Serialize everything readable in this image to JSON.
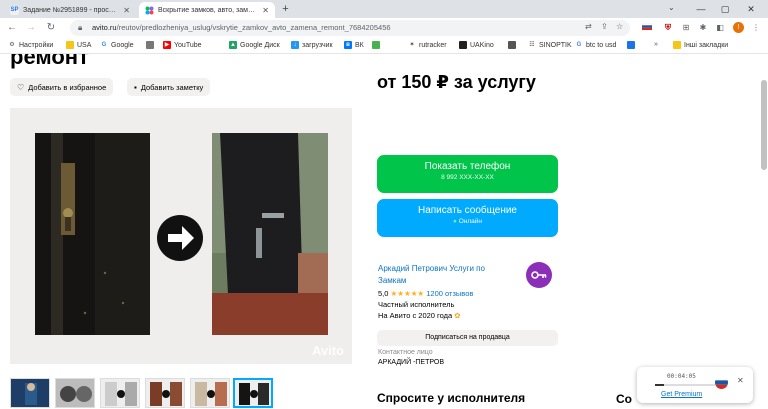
{
  "browser": {
    "tabs": [
      {
        "title": "Задание №2951899 - просмотр",
        "favicon": "SP",
        "active": false
      },
      {
        "title": "Вскрытие замков, авто, замена",
        "favicon": "avito",
        "active": true
      }
    ],
    "url_host": "avito.ru",
    "url_path": "/reutov/predlozheniya_uslug/vskrytie_zamkov_avto_zamena_remont_7684205456"
  },
  "bookmarks": {
    "items": [
      "Настройки",
      "USA",
      "Google",
      "",
      "YouTube",
      "Google Диск",
      "загрузчик",
      "ВК",
      "",
      "rutracker",
      "UAKino",
      "",
      "SINOPTIK",
      "btc to usd",
      ""
    ],
    "other": "Інші закладки"
  },
  "page": {
    "title_partial": "ремонт",
    "favorite_label": "Добавить в избранное",
    "note_label": "Добавить заметку",
    "watermark": "Avito",
    "price": "от 150 ₽ за услугу",
    "phone_button": {
      "label": "Показать телефон",
      "sub": "8 992 XXX-XX-XX"
    },
    "message_button": {
      "label": "Написать сообщение",
      "sub": "Онлайн"
    },
    "seller": {
      "name_line1": "Аркадий Петрович Услуги по",
      "name_line2": "Замкам",
      "rating": "5,0",
      "stars": "★★★★★",
      "reviews": "1200 отзывов",
      "type": "Частный исполнитель",
      "since": "На Авито с 2020 года"
    },
    "subscribe_label": "Подписаться на продавца",
    "contact_label": "Контактное лицо",
    "contact_name": "АРКАДИЙ -ПЕТРОВ",
    "ask_heading": "Спросите у исполнителя",
    "co_partial": "Со"
  },
  "recorder": {
    "time": "00:04:05",
    "premium": "Get Premium",
    "progress": 0.15
  },
  "colors": {
    "phone_green": "#00c54a",
    "message_blue": "#00aaff",
    "seller_purple": "#8b2fb8",
    "link_blue": "#0a74c7"
  }
}
